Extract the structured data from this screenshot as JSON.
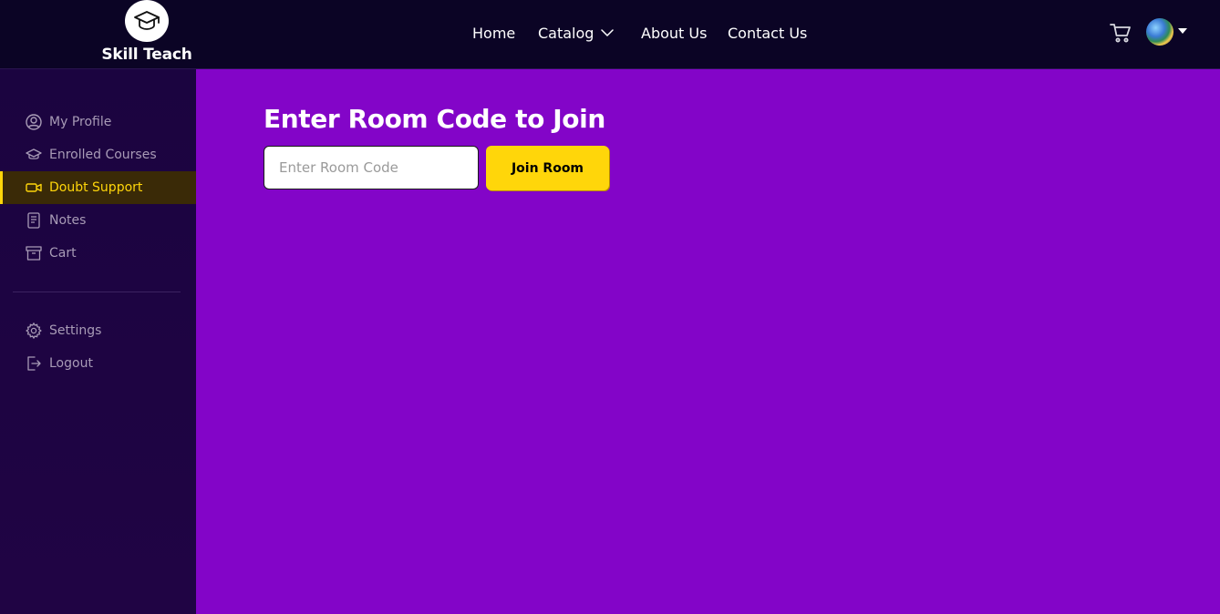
{
  "brand": {
    "name": "Skill Teach",
    "logo_icon": "graduation-cap-icon"
  },
  "nav": {
    "items": [
      {
        "label": "Home"
      },
      {
        "label": "Catalog",
        "icon": "chevron-down-icon"
      },
      {
        "label": "About Us"
      },
      {
        "label": "Contact Us"
      }
    ]
  },
  "header_right": {
    "cart_icon": "cart-icon",
    "avatar": "user-avatar"
  },
  "sidebar": {
    "items": [
      {
        "label": "My Profile",
        "icon": "user-circle-icon"
      },
      {
        "label": "Enrolled Courses",
        "icon": "graduation-cap-icon"
      },
      {
        "label": "Doubt Support",
        "icon": "video-camera-icon",
        "active": true
      },
      {
        "label": "Notes",
        "icon": "notebook-icon"
      },
      {
        "label": "Cart",
        "icon": "archive-box-icon"
      }
    ],
    "bottom_items": [
      {
        "label": "Settings",
        "icon": "gear-icon"
      },
      {
        "label": "Logout",
        "icon": "logout-icon"
      }
    ]
  },
  "main": {
    "title": "Enter Room Code to Join",
    "room_input": {
      "placeholder": "Enter Room Code",
      "value": ""
    },
    "join_button": "Join Room"
  },
  "colors": {
    "accent": "#ffd60a",
    "background": "#8305c8",
    "header": "#0b0425",
    "sidebar": "#1b0440"
  }
}
